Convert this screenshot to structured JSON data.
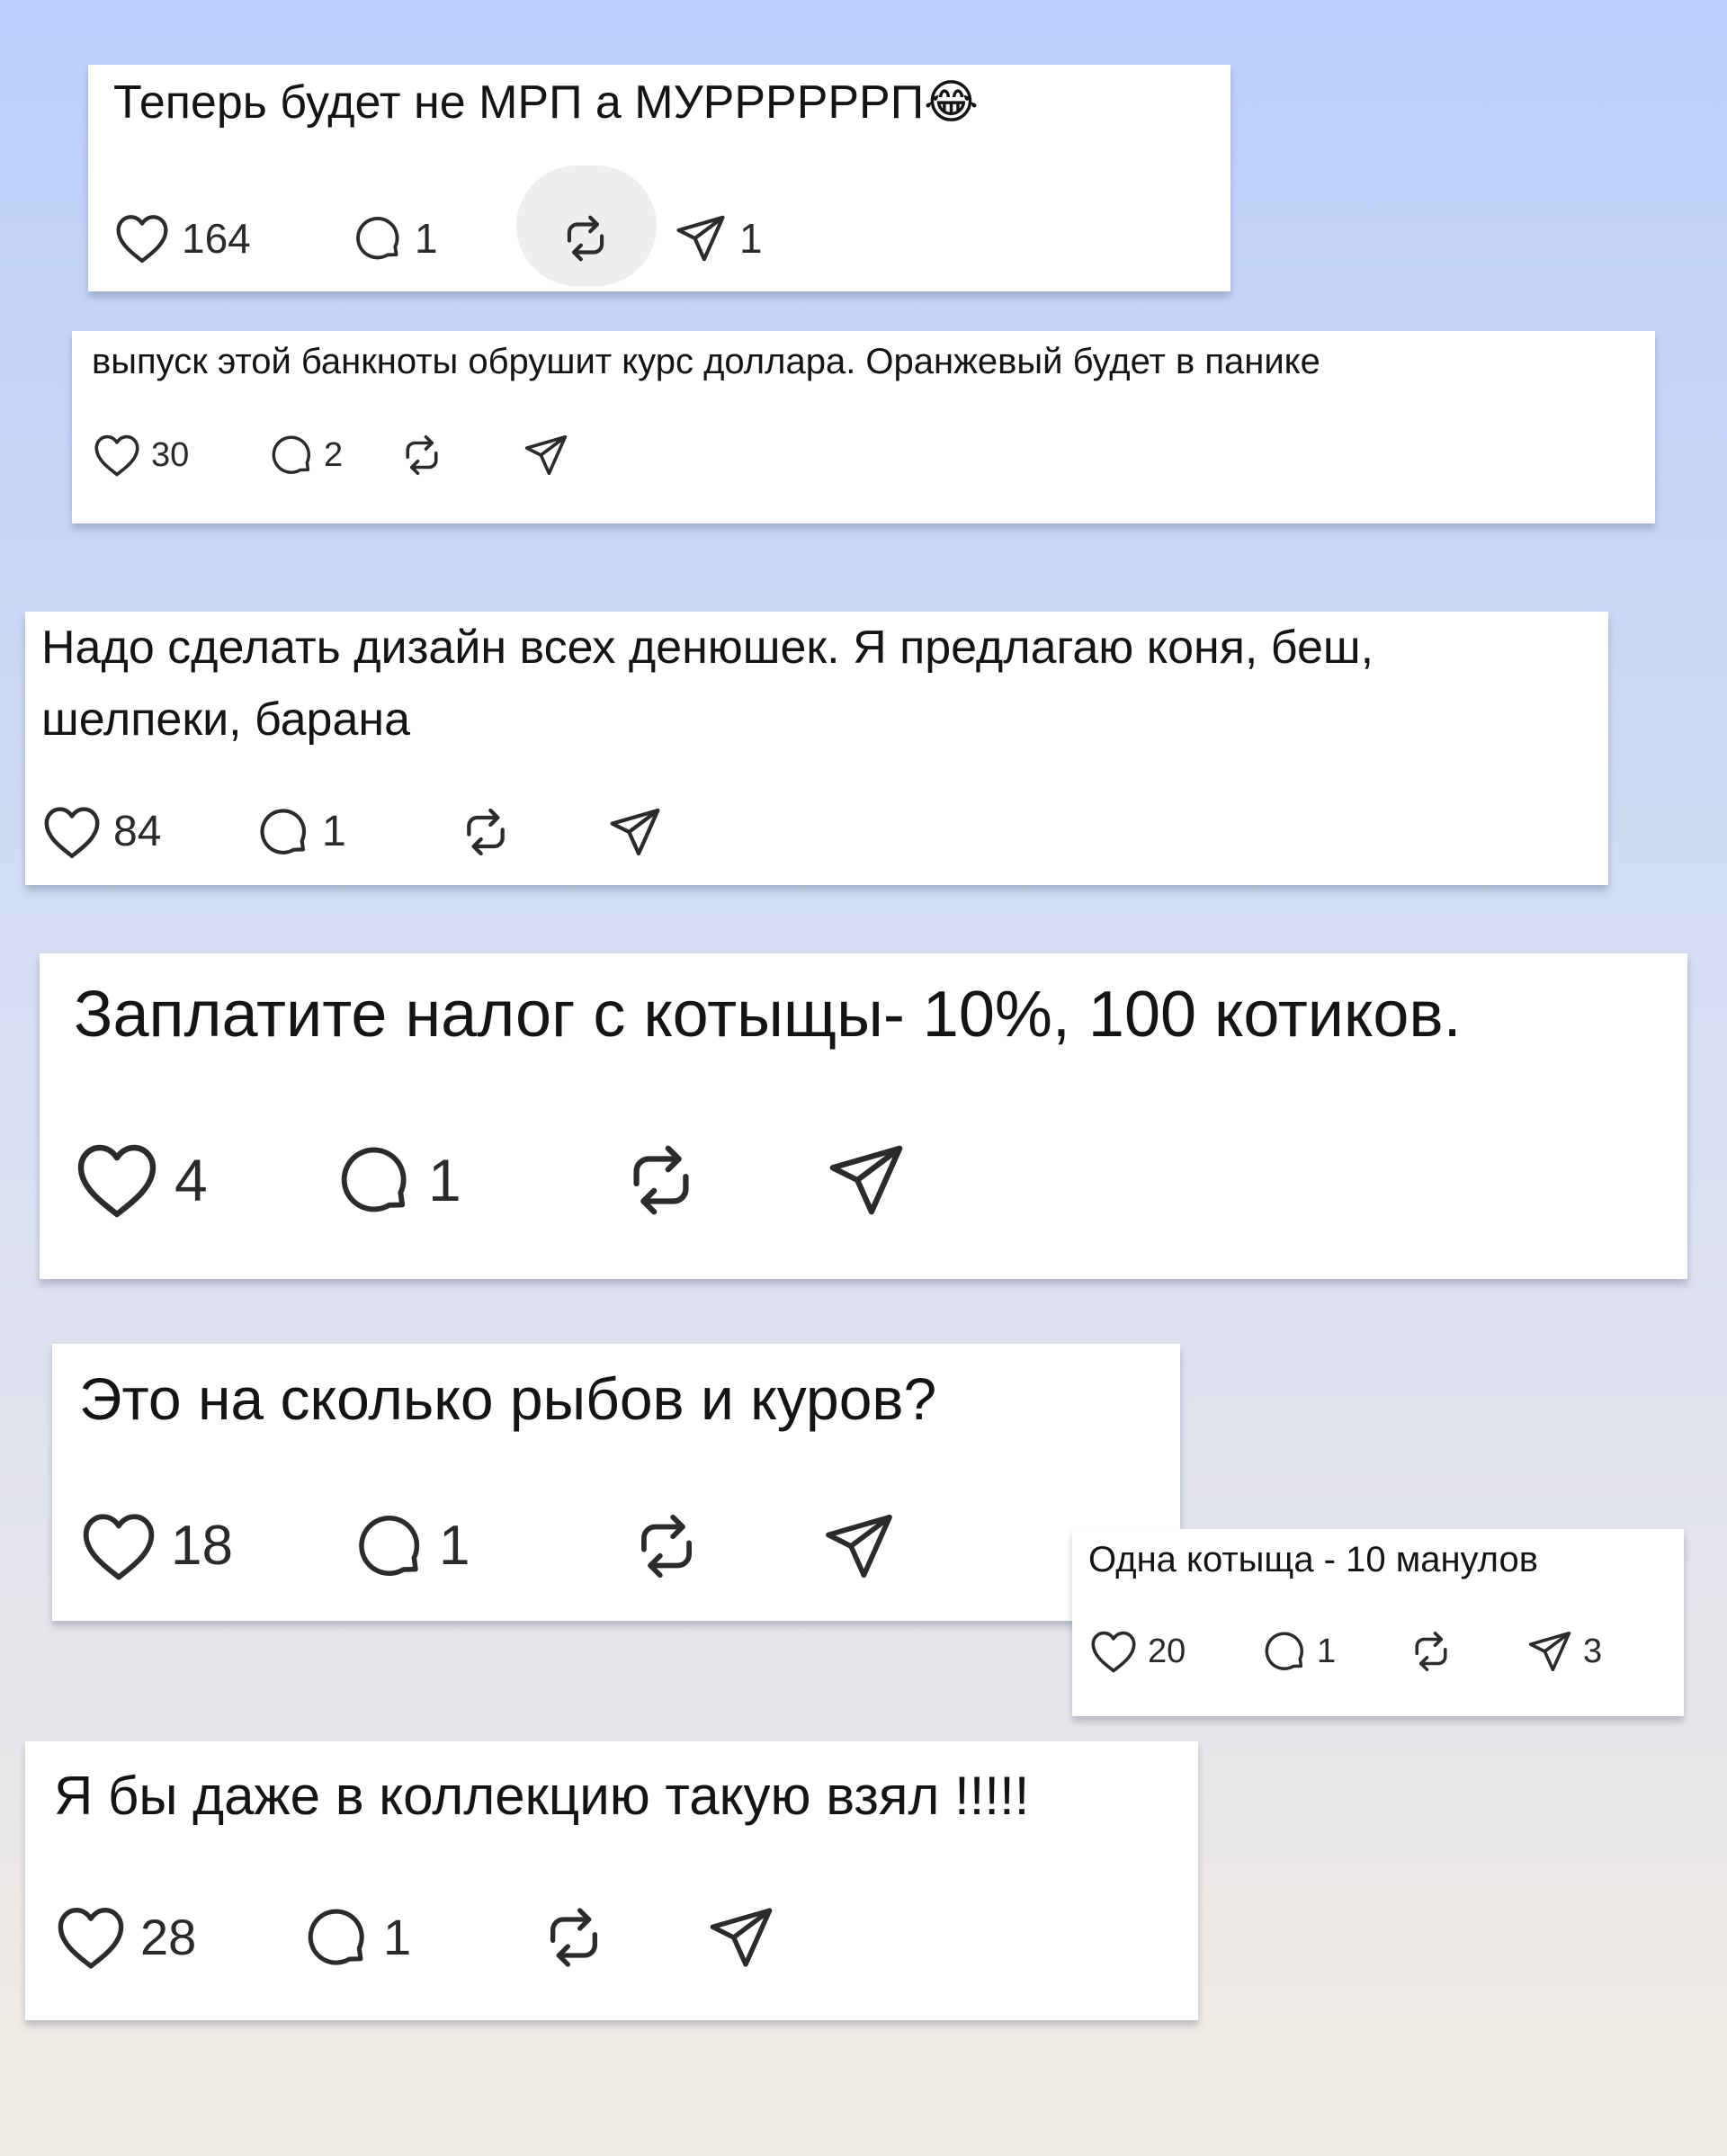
{
  "comments": [
    {
      "text": "Теперь будет не МРП а МУРРРРРРП😂",
      "likes": "164",
      "replies": "1",
      "reposts": "",
      "shares": "1"
    },
    {
      "text": "выпуск этой банкноты обрушит курс доллара. Оранжевый будет в панике",
      "likes": "30",
      "replies": "2",
      "reposts": "",
      "shares": ""
    },
    {
      "text": "Надо сделать дизайн всех денюшек. Я предлагаю коня, беш, шелпеки, барана",
      "likes": "84",
      "replies": "1",
      "reposts": "",
      "shares": ""
    },
    {
      "text": "Заплатите налог с котыщы- 10%, 100 котиков.",
      "likes": "4",
      "replies": "1",
      "reposts": "",
      "shares": ""
    },
    {
      "text": "Это на сколько рыбов и куров?",
      "likes": "18",
      "replies": "1",
      "reposts": "",
      "shares": ""
    },
    {
      "text": "Одна котыща - 10 манулов",
      "likes": "20",
      "replies": "1",
      "reposts": "",
      "shares": "3"
    },
    {
      "text": "Я бы даже в коллекцию такую взял !!!!!",
      "likes": "28",
      "replies": "1",
      "reposts": "",
      "shares": ""
    }
  ],
  "icons": {
    "like": "heart-icon",
    "reply": "comment-bubble-icon",
    "repost": "repost-arrows-icon",
    "share": "paper-plane-icon"
  },
  "colors": {
    "card": "#ffffff",
    "icon": "#2b2b2b",
    "text": "#141414",
    "repost_highlight": "#eeeeee"
  }
}
